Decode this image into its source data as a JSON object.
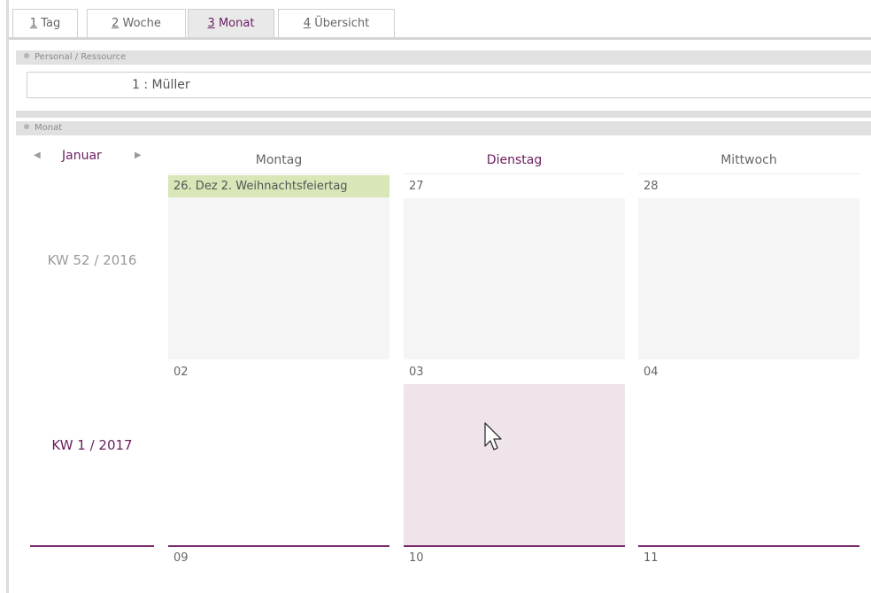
{
  "tabs": [
    {
      "key": "1",
      "label": " Tag",
      "active": false
    },
    {
      "key": "2",
      "label": " Woche",
      "active": false
    },
    {
      "key": "3",
      "label": " Monat",
      "active": true
    },
    {
      "key": "4",
      "label": " Übersicht",
      "active": false
    }
  ],
  "personal": {
    "header": "Personal / Ressource",
    "value": "1  : Müller"
  },
  "month_panel": {
    "header": "Monat",
    "month_label": "Januar",
    "prev_icon": "triangle-left-icon",
    "next_icon": "triangle-right-icon",
    "day_headers": [
      "Montag",
      "Dienstag",
      "Mittwoch"
    ],
    "today_header": "Dienstag",
    "weeks": [
      {
        "label": "KW 52 / 2016",
        "days": [
          {
            "num": "26. Dez 2. Weihnachtsfeiertag",
            "holiday": true
          },
          {
            "num": "27"
          },
          {
            "num": "28"
          }
        ]
      },
      {
        "label": "KW 1 / 2017",
        "days": [
          {
            "num": "02"
          },
          {
            "num": "03",
            "selected": true
          },
          {
            "num": "04"
          }
        ]
      },
      {
        "label": "",
        "days": [
          {
            "num": "09"
          },
          {
            "num": "10"
          },
          {
            "num": "11"
          }
        ]
      }
    ]
  },
  "colors": {
    "accent": "#6b1d5f",
    "holiday": "#d8e6b8",
    "selected_cell": "#efe4ec"
  }
}
